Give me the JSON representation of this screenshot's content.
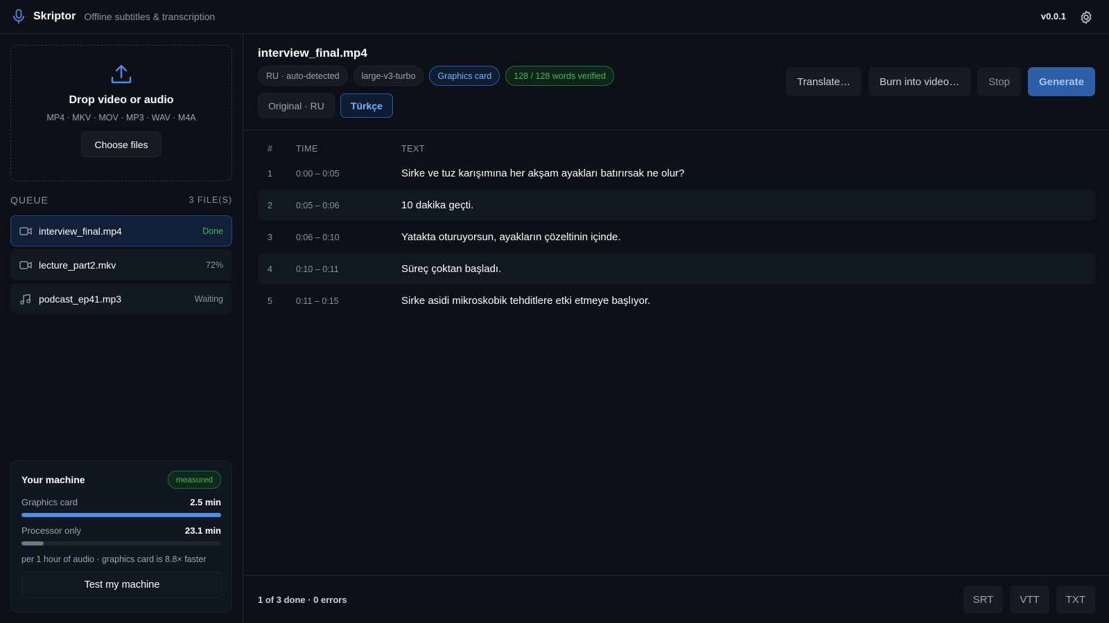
{
  "header": {
    "app_name": "Skriptor",
    "tagline": "Offline subtitles & transcription",
    "version": "v0.0.1",
    "icons": {
      "logo": "microphone-icon",
      "settings": "gear-icon"
    }
  },
  "sidebar": {
    "dropzone": {
      "title": "Drop video or audio",
      "formats": "MP4 · MKV · MOV · MP3 · WAV · M4A",
      "choose_label": "Choose files"
    },
    "queue": {
      "title": "QUEUE",
      "count": "3 FILE(S)",
      "items": [
        {
          "name": "interview_final.mp4",
          "status": "Done",
          "icon": "video-icon",
          "active": true
        },
        {
          "name": "lecture_part2.mkv",
          "status": "72%",
          "icon": "video-icon",
          "active": false
        },
        {
          "name": "podcast_ep41.mp3",
          "status": "Waiting",
          "icon": "music-note-icon",
          "active": false
        }
      ]
    },
    "machine": {
      "title": "Your machine",
      "badge": "measured",
      "gpu_label": "Graphics card",
      "gpu_value": "2.5 min",
      "gpu_fill": 1.0,
      "cpu_label": "Processor only",
      "cpu_value": "23.1 min",
      "cpu_fill": 0.11,
      "note": "per 1 hour of audio · graphics card is 8.8× faster",
      "test_label": "Test my machine"
    }
  },
  "main": {
    "file_title": "interview_final.mp4",
    "chips": {
      "language": "RU · auto-detected",
      "model": "large-v3-turbo",
      "device": "Graphics card",
      "verified": "128 / 128 words verified"
    },
    "tabs": [
      {
        "label": "Original · RU",
        "active": false
      },
      {
        "label": "Türkçe",
        "active": true
      }
    ],
    "actions": {
      "translate": "Translate…",
      "burn": "Burn into video…",
      "stop": "Stop",
      "generate": "Generate"
    },
    "table": {
      "headers": {
        "num": "#",
        "time": "TIME",
        "text": "TEXT"
      },
      "rows": [
        {
          "num": "1",
          "time": "0:00 – 0:05",
          "text": "Sirke ve tuz karışımına her akşam ayakları batırırsak ne olur?"
        },
        {
          "num": "2",
          "time": "0:05 – 0:06",
          "text": "10 dakika geçti."
        },
        {
          "num": "3",
          "time": "0:06 – 0:10",
          "text": "Yatakta oturuyorsun, ayakların çözeltinin içinde."
        },
        {
          "num": "4",
          "time": "0:10 – 0:11",
          "text": "Süreç çoktan başladı."
        },
        {
          "num": "5",
          "time": "0:11 – 0:15",
          "text": "Sirke asidi mikroskobik tehditlere etki etmeye başlıyor."
        }
      ]
    },
    "footer": {
      "summary": "1 of 3 done · 0 errors",
      "exports": [
        "SRT",
        "VTT",
        "TXT"
      ]
    }
  },
  "colors": {
    "background": "#0d1117",
    "accent": "#4a8fe7",
    "success": "#3fb950",
    "primary_button": "#2d5fa8"
  }
}
